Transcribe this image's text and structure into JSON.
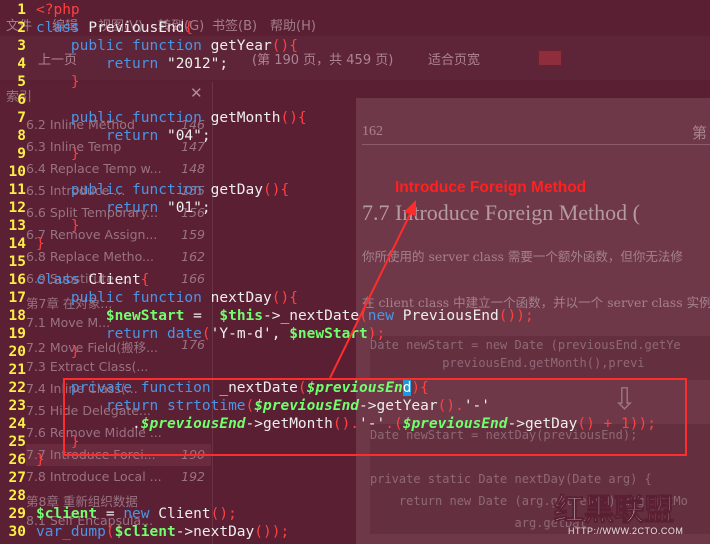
{
  "reader": {
    "menu": [
      "文件",
      "编辑",
      "视图(V)",
      "转到(G)",
      "书签(B)",
      "帮助(H)"
    ],
    "toolbar": {
      "prev_page": "上一页",
      "page_info": "(第 190 页，共 459 页)",
      "zoom": "适合页宽"
    },
    "sidebar": {
      "header": "索引",
      "items": [
        {
          "label": "6.2 Inline Method",
          "page": "146"
        },
        {
          "label": "6.3 Inline Temp",
          "page": "147"
        },
        {
          "label": "6.4 Replace Temp w...",
          "page": "148"
        },
        {
          "label": "6.5 Introduce ...",
          "page": "155"
        },
        {
          "label": "6.6 Split Temporary...",
          "page": "156"
        },
        {
          "label": "6.7 Remove Assign...",
          "page": "159"
        },
        {
          "label": "6.8 Replace Metho...",
          "page": "162"
        },
        {
          "label": "6.9 Substitute ...",
          "page": "166"
        },
        {
          "label": "第7章 在对象...",
          "page": ""
        },
        {
          "label": "7.1 Move M...",
          "page": ""
        },
        {
          "label": "7.2 Move Field(搬移...",
          "page": "176"
        },
        {
          "label": "7.3 Extract Class(...",
          "page": ""
        },
        {
          "label": "7.4 Inline Class(...",
          "page": ""
        },
        {
          "label": "7.5 Hide Delegate...",
          "page": ""
        },
        {
          "label": "7.6 Remove Middle ...",
          "page": ""
        },
        {
          "label": "7.7 Introduce Forei...",
          "page": "190"
        },
        {
          "label": "7.8 Introduce Local ...",
          "page": "192"
        },
        {
          "label": "第8章 重新组织数据",
          "page": ""
        },
        {
          "label": "8.1 Self Encapsula...",
          "page": ""
        }
      ]
    },
    "page": {
      "number": "162",
      "right_header": "第",
      "section_title": "7.7  Introduce Foreign Method (",
      "para1": "你所使用的 server class 需要一个额外函数，但你无法修",
      "para2": "在 client class 中建立一个函数，并以一个 server class 实例",
      "code1": [
        "Date newStart = new Date (previousEnd.getYe",
        "          previousEnd.getMonth(),previ"
      ],
      "code2": [
        "Date newStart = nextDay(previousEnd);",
        "",
        "private static Date nextDay(Date arg) {",
        "    return new Date (arg.getYear(),arg.getMo",
        "                    arg.getDat"
      ]
    }
  },
  "annotation": {
    "title": "Introduce Foreign Method"
  },
  "watermark": {
    "text": "红黑联盟",
    "url": "HTTP://WWW.2CTO.COM"
  },
  "code_lines": [
    {
      "n": "1"
    },
    {
      "n": "2"
    },
    {
      "n": "3"
    },
    {
      "n": "4"
    },
    {
      "n": "5"
    },
    {
      "n": "6"
    },
    {
      "n": "7"
    },
    {
      "n": "8"
    },
    {
      "n": "9"
    },
    {
      "n": "10"
    },
    {
      "n": "11"
    },
    {
      "n": "12"
    },
    {
      "n": "13"
    },
    {
      "n": "14"
    },
    {
      "n": "15"
    },
    {
      "n": "16"
    },
    {
      "n": "17"
    },
    {
      "n": "18"
    },
    {
      "n": "19"
    },
    {
      "n": "20"
    },
    {
      "n": "21"
    },
    {
      "n": "22"
    },
    {
      "n": "23"
    },
    {
      "n": "24"
    },
    {
      "n": "25"
    },
    {
      "n": "26"
    },
    {
      "n": "27"
    },
    {
      "n": "28"
    },
    {
      "n": "29"
    },
    {
      "n": "30"
    }
  ],
  "code": {
    "l1": {
      "open": "<?php"
    },
    "l2": {
      "kw": "class",
      "name": " PreviousEnd",
      "brace": "{"
    },
    "l3": {
      "kw1": "public",
      "kw2": " function",
      "name": " getYear",
      "paren": "(){"
    },
    "l4": {
      "kw": "return",
      "val": " \"2012\"",
      "end": ";"
    },
    "l5": {
      "brace": "}"
    },
    "l7": {
      "kw1": "public",
      "kw2": " function",
      "name": " getMonth",
      "paren": "(){"
    },
    "l8": {
      "kw": "return",
      "val": " \"04\"",
      "end": ";"
    },
    "l9": {
      "brace": "}"
    },
    "l10": {
      "kw1": "public",
      "kw2": " function",
      "name": " getDay",
      "paren": "(){"
    },
    "l11": {
      "kw": "return",
      "val": " \"01\"",
      "end": ";"
    },
    "l12": {
      "brace": "}"
    },
    "l13": {
      "brace": "}"
    },
    "l14": {
      "kw": "class",
      "name": " Client",
      "brace": "{"
    },
    "l15": {
      "kw1": "public",
      "kw2": " function",
      "name": " nextDay",
      "paren": "(){"
    },
    "l16": {
      "var": "$newStart",
      "eq": " = ",
      "this": "$this",
      "arrow": "->",
      "call": "_nextDate",
      "p1": "(",
      "kwnew": "new",
      "cls": " PreviousEnd",
      "p2": "());"
    },
    "l17": {
      "kw": "return",
      "fn": " date",
      "p1": "(",
      "s1": "'Y-m-d'",
      "comma": ", ",
      "var": "$newStart",
      "p2": ");"
    },
    "l18": {
      "brace": "}"
    },
    "l22": {
      "kw1": "private",
      "kw2": " function",
      "name": " _nextDate",
      "p1": "(",
      "var": "$previousEn",
      "cur": "d",
      "p2": "){"
    },
    "l23": {
      "kw": "return",
      "fn": " strtotime",
      "p1": "(",
      "var": "$previousEnd",
      "arrow": "->",
      "call": "getYear",
      "p2": "().",
      "s1": "'-'"
    },
    "l24": {
      "dot": ".",
      "var": "$previousEnd",
      "arrow": "->",
      "call": "getMonth",
      "p1": "().",
      "s1": "'-'",
      "dot2": ".(",
      "var2": "$previousEnd",
      "arrow2": "->",
      "call2": "getDay",
      "p2": "() + 1",
      "p3": "));"
    },
    "l25": {
      "brace": "}"
    },
    "l26": {
      "brace": "}"
    },
    "l29": {
      "var": "$client",
      "eq": " = ",
      "kwnew": "new",
      "cls": " Client",
      "p": "();"
    },
    "l30": {
      "fn": "var_dump",
      "p1": "(",
      "var": "$client",
      "arrow": "->",
      "call": "nextDay",
      "p2": "());"
    }
  }
}
